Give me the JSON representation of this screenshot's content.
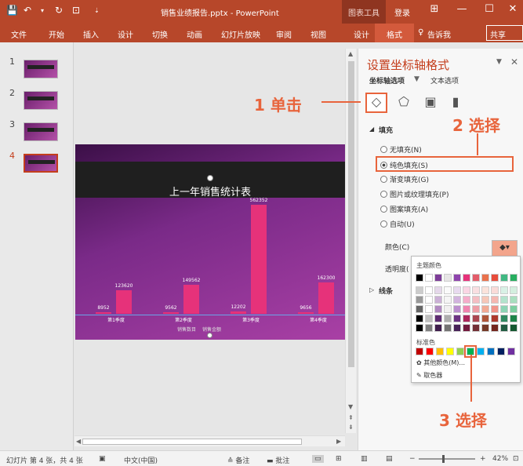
{
  "window": {
    "title": "销售业绩报告.pptx - PowerPoint",
    "chart_tools": "图表工具",
    "login": "登录"
  },
  "ribbon": {
    "tabs": [
      "文件",
      "开始",
      "插入",
      "设计",
      "切换",
      "动画",
      "幻灯片放映",
      "审阅",
      "视图"
    ],
    "context_tabs": [
      "设计",
      "格式"
    ],
    "tell_me": "告诉我",
    "share": "共享"
  },
  "slides": {
    "numbers": [
      "1",
      "2",
      "3",
      "4"
    ],
    "active": "4"
  },
  "slide": {
    "title": "上一年销售统计表",
    "legend": [
      "销售数目",
      "销售金额"
    ]
  },
  "chart_data": {
    "type": "bar",
    "categories": [
      "第1季度",
      "第2季度",
      "第3季度",
      "第4季度"
    ],
    "series": [
      {
        "name": "销售数目",
        "values": [
          8952,
          9562,
          12202,
          9656
        ]
      },
      {
        "name": "销售金额",
        "values": [
          123620,
          149562,
          562352,
          162300
        ]
      }
    ],
    "value_labels": [
      "8952",
      "123620",
      "9562",
      "149562",
      "12202",
      "562352",
      "9656",
      "162300"
    ],
    "title": "上一年销售统计表",
    "ylim": [
      0,
      600000
    ]
  },
  "format_pane": {
    "title": "设置坐标轴格式",
    "tab_axis": "坐标轴选项",
    "tab_text": "文本选项",
    "section_fill": "填充",
    "options": [
      "无填充(N)",
      "纯色填充(S)",
      "渐变填充(G)",
      "图片或纹理填充(P)",
      "图案填充(A)",
      "自动(U)"
    ],
    "selected_option": "纯色填充(S)",
    "color_label": "颜色(C)",
    "transparency_label": "透明度(",
    "section_line": "线条"
  },
  "palette": {
    "theme_header": "主题颜色",
    "standard_header": "标准色",
    "more_colors": "其他颜色(M)...",
    "eyedropper": "取色器",
    "theme_top": [
      "#000000",
      "#ffffff",
      "#7d3c98",
      "#e7e6e6",
      "#8e44ad",
      "#e6327a",
      "#e35d6a",
      "#e9724d",
      "#e74c3c",
      "#41b883",
      "#27ae60"
    ],
    "standard": [
      "#c00000",
      "#ff0000",
      "#ffc000",
      "#ffff00",
      "#92d050",
      "#00b050",
      "#00b0f0",
      "#0070c0",
      "#002060",
      "#7030a0"
    ]
  },
  "annotations": {
    "click": "1 单击",
    "select2": "2 选择",
    "select3": "3 选择"
  },
  "status": {
    "slide_info": "幻灯片 第 4 张，共 4 张",
    "language": "中文(中国)",
    "notes": "备注",
    "comments": "批注",
    "zoom": "42%"
  }
}
